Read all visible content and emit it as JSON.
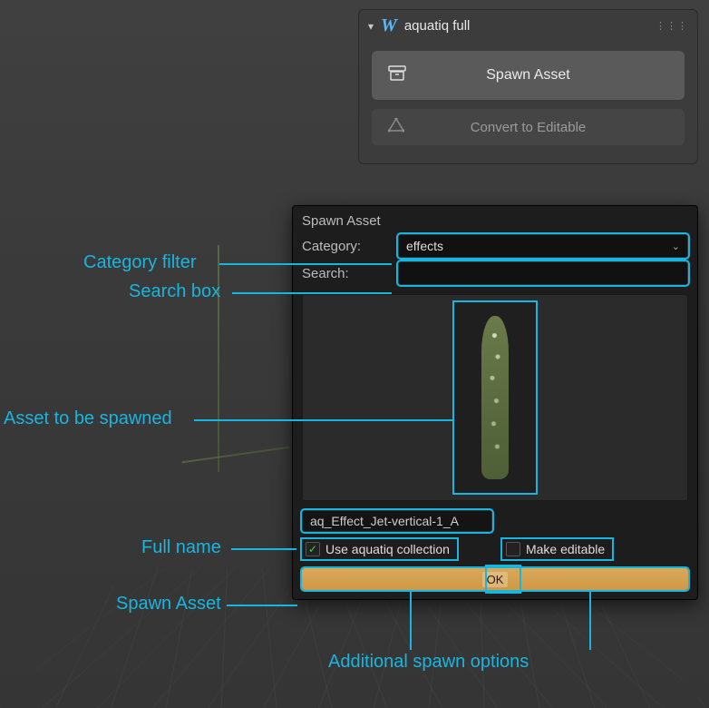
{
  "panel": {
    "title": "aquatiq full",
    "spawn_btn": "Spawn Asset",
    "convert_btn": "Convert to Editable"
  },
  "popup": {
    "title": "Spawn Asset",
    "category_label": "Category:",
    "category_value": "effects",
    "search_label": "Search:",
    "search_value": "",
    "asset_name": "aq_Effect_Jet-vertical-1_A",
    "use_collection_label": "Use aquatiq collection",
    "use_collection_checked": true,
    "make_editable_label": "Make editable",
    "make_editable_checked": false,
    "ok_label": "OK"
  },
  "annotations": {
    "category": "Category filter",
    "search": "Search box",
    "asset": "Asset to be spawned",
    "fullname": "Full name",
    "spawn": "Spawn Asset",
    "options": "Additional spawn options"
  }
}
